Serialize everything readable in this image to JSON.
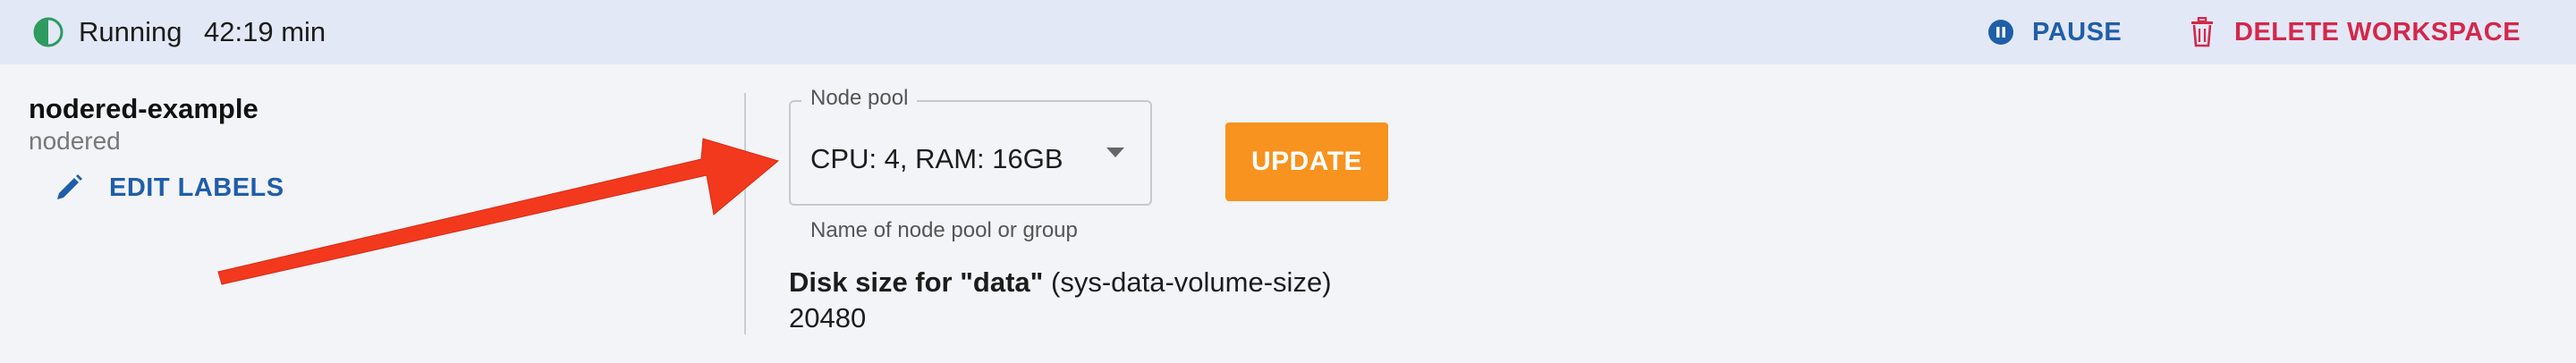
{
  "status": {
    "state": "Running",
    "elapsed": "42:19 min",
    "pause_label": "PAUSE",
    "delete_label": "DELETE WORKSPACE"
  },
  "workspace": {
    "name": "nodered-example",
    "type": "nodered",
    "edit_labels_label": "EDIT LABELS"
  },
  "node_pool": {
    "legend": "Node pool",
    "selected": "CPU: 4, RAM: 16GB",
    "helper": "Name of node pool or group"
  },
  "update_label": "UPDATE",
  "disk": {
    "label_bold": "Disk size for \"data\"",
    "label_rest": "(sys-data-volume-size)",
    "value": "20480"
  },
  "icons": {
    "status": "half-circle-status-icon",
    "pause": "pause-circle-icon",
    "delete": "trash-icon",
    "edit": "pencil-icon",
    "select": "caret-down-icon"
  },
  "colors": {
    "running": "#2e9b5f",
    "primary": "#1f5ea8",
    "danger": "#d3284a",
    "update": "#f7931e",
    "annotation_arrow": "#f2391e"
  }
}
